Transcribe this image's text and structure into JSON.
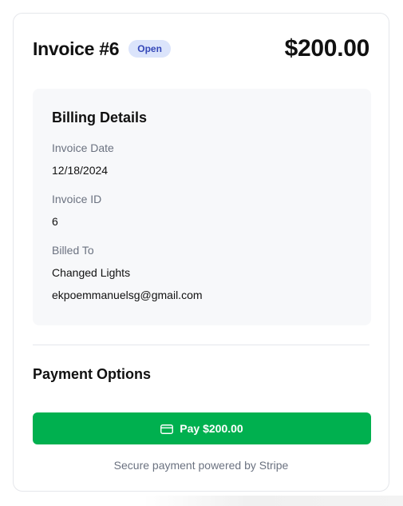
{
  "invoice": {
    "title": "Invoice #6",
    "status": "Open",
    "amount": "$200.00"
  },
  "billing": {
    "heading": "Billing Details",
    "invoice_date_label": "Invoice Date",
    "invoice_date": "12/18/2024",
    "invoice_id_label": "Invoice ID",
    "invoice_id": "6",
    "billed_to_label": "Billed To",
    "billed_to_name": "Changed Lights",
    "billed_to_email": "ekpoemmanuelsg@gmail.com"
  },
  "payment": {
    "heading": "Payment Options",
    "pay_button_label": "Pay $200.00",
    "pay_icon": "credit-card-icon",
    "secure_note": "Secure payment powered by Stripe"
  },
  "colors": {
    "accent_green": "#00b04f",
    "badge_bg": "#dbe4fb",
    "badge_text": "#3447b8",
    "panel_bg": "#f7f8fa"
  }
}
